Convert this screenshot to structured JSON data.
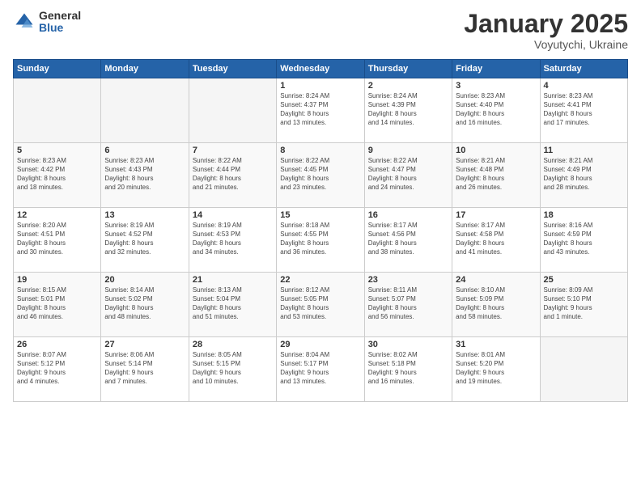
{
  "logo": {
    "general": "General",
    "blue": "Blue"
  },
  "header": {
    "title": "January 2025",
    "subtitle": "Voyutychi, Ukraine"
  },
  "columns": [
    "Sunday",
    "Monday",
    "Tuesday",
    "Wednesday",
    "Thursday",
    "Friday",
    "Saturday"
  ],
  "weeks": [
    [
      {
        "day": "",
        "info": ""
      },
      {
        "day": "",
        "info": ""
      },
      {
        "day": "",
        "info": ""
      },
      {
        "day": "1",
        "info": "Sunrise: 8:24 AM\nSunset: 4:37 PM\nDaylight: 8 hours\nand 13 minutes."
      },
      {
        "day": "2",
        "info": "Sunrise: 8:24 AM\nSunset: 4:39 PM\nDaylight: 8 hours\nand 14 minutes."
      },
      {
        "day": "3",
        "info": "Sunrise: 8:23 AM\nSunset: 4:40 PM\nDaylight: 8 hours\nand 16 minutes."
      },
      {
        "day": "4",
        "info": "Sunrise: 8:23 AM\nSunset: 4:41 PM\nDaylight: 8 hours\nand 17 minutes."
      }
    ],
    [
      {
        "day": "5",
        "info": "Sunrise: 8:23 AM\nSunset: 4:42 PM\nDaylight: 8 hours\nand 18 minutes."
      },
      {
        "day": "6",
        "info": "Sunrise: 8:23 AM\nSunset: 4:43 PM\nDaylight: 8 hours\nand 20 minutes."
      },
      {
        "day": "7",
        "info": "Sunrise: 8:22 AM\nSunset: 4:44 PM\nDaylight: 8 hours\nand 21 minutes."
      },
      {
        "day": "8",
        "info": "Sunrise: 8:22 AM\nSunset: 4:45 PM\nDaylight: 8 hours\nand 23 minutes."
      },
      {
        "day": "9",
        "info": "Sunrise: 8:22 AM\nSunset: 4:47 PM\nDaylight: 8 hours\nand 24 minutes."
      },
      {
        "day": "10",
        "info": "Sunrise: 8:21 AM\nSunset: 4:48 PM\nDaylight: 8 hours\nand 26 minutes."
      },
      {
        "day": "11",
        "info": "Sunrise: 8:21 AM\nSunset: 4:49 PM\nDaylight: 8 hours\nand 28 minutes."
      }
    ],
    [
      {
        "day": "12",
        "info": "Sunrise: 8:20 AM\nSunset: 4:51 PM\nDaylight: 8 hours\nand 30 minutes."
      },
      {
        "day": "13",
        "info": "Sunrise: 8:19 AM\nSunset: 4:52 PM\nDaylight: 8 hours\nand 32 minutes."
      },
      {
        "day": "14",
        "info": "Sunrise: 8:19 AM\nSunset: 4:53 PM\nDaylight: 8 hours\nand 34 minutes."
      },
      {
        "day": "15",
        "info": "Sunrise: 8:18 AM\nSunset: 4:55 PM\nDaylight: 8 hours\nand 36 minutes."
      },
      {
        "day": "16",
        "info": "Sunrise: 8:17 AM\nSunset: 4:56 PM\nDaylight: 8 hours\nand 38 minutes."
      },
      {
        "day": "17",
        "info": "Sunrise: 8:17 AM\nSunset: 4:58 PM\nDaylight: 8 hours\nand 41 minutes."
      },
      {
        "day": "18",
        "info": "Sunrise: 8:16 AM\nSunset: 4:59 PM\nDaylight: 8 hours\nand 43 minutes."
      }
    ],
    [
      {
        "day": "19",
        "info": "Sunrise: 8:15 AM\nSunset: 5:01 PM\nDaylight: 8 hours\nand 46 minutes."
      },
      {
        "day": "20",
        "info": "Sunrise: 8:14 AM\nSunset: 5:02 PM\nDaylight: 8 hours\nand 48 minutes."
      },
      {
        "day": "21",
        "info": "Sunrise: 8:13 AM\nSunset: 5:04 PM\nDaylight: 8 hours\nand 51 minutes."
      },
      {
        "day": "22",
        "info": "Sunrise: 8:12 AM\nSunset: 5:05 PM\nDaylight: 8 hours\nand 53 minutes."
      },
      {
        "day": "23",
        "info": "Sunrise: 8:11 AM\nSunset: 5:07 PM\nDaylight: 8 hours\nand 56 minutes."
      },
      {
        "day": "24",
        "info": "Sunrise: 8:10 AM\nSunset: 5:09 PM\nDaylight: 8 hours\nand 58 minutes."
      },
      {
        "day": "25",
        "info": "Sunrise: 8:09 AM\nSunset: 5:10 PM\nDaylight: 9 hours\nand 1 minute."
      }
    ],
    [
      {
        "day": "26",
        "info": "Sunrise: 8:07 AM\nSunset: 5:12 PM\nDaylight: 9 hours\nand 4 minutes."
      },
      {
        "day": "27",
        "info": "Sunrise: 8:06 AM\nSunset: 5:14 PM\nDaylight: 9 hours\nand 7 minutes."
      },
      {
        "day": "28",
        "info": "Sunrise: 8:05 AM\nSunset: 5:15 PM\nDaylight: 9 hours\nand 10 minutes."
      },
      {
        "day": "29",
        "info": "Sunrise: 8:04 AM\nSunset: 5:17 PM\nDaylight: 9 hours\nand 13 minutes."
      },
      {
        "day": "30",
        "info": "Sunrise: 8:02 AM\nSunset: 5:18 PM\nDaylight: 9 hours\nand 16 minutes."
      },
      {
        "day": "31",
        "info": "Sunrise: 8:01 AM\nSunset: 5:20 PM\nDaylight: 9 hours\nand 19 minutes."
      },
      {
        "day": "",
        "info": ""
      }
    ]
  ]
}
